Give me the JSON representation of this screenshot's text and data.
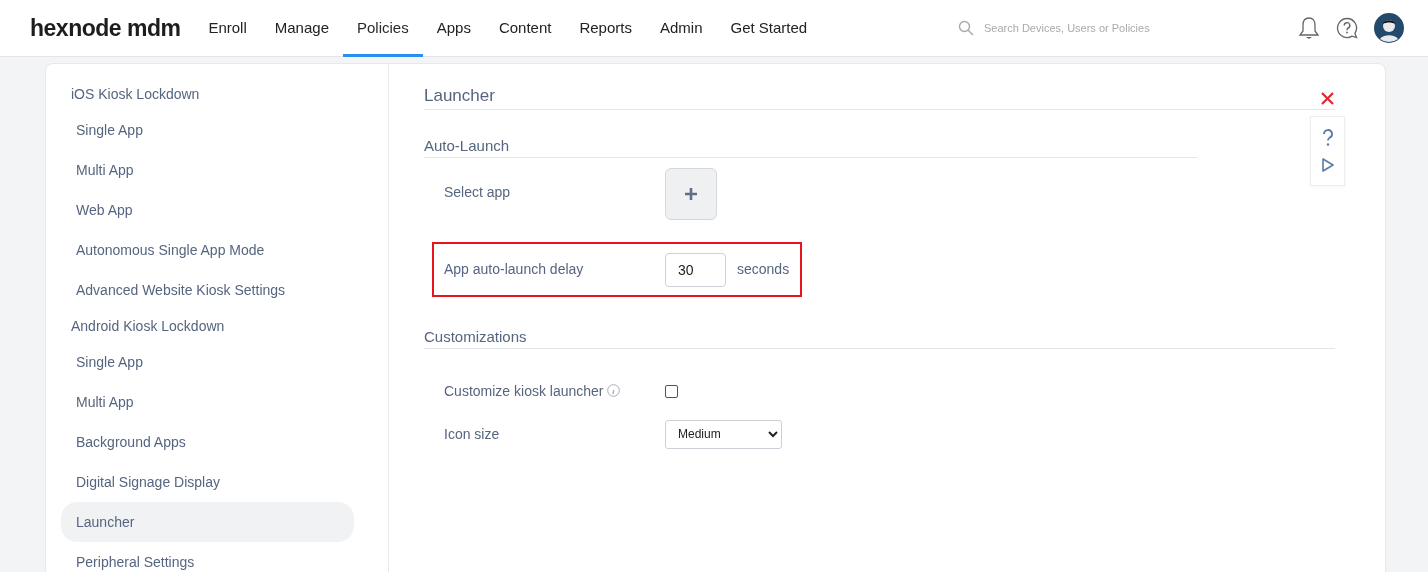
{
  "brand": {
    "name": "hexnode mdm"
  },
  "nav": [
    {
      "label": "Enroll",
      "selected": false
    },
    {
      "label": "Manage",
      "selected": false
    },
    {
      "label": "Policies",
      "selected": true
    },
    {
      "label": "Apps",
      "selected": false
    },
    {
      "label": "Content",
      "selected": false
    },
    {
      "label": "Reports",
      "selected": false
    },
    {
      "label": "Admin",
      "selected": false
    },
    {
      "label": "Get Started",
      "selected": false
    }
  ],
  "search": {
    "placeholder": "Search Devices, Users or Policies"
  },
  "sidebar": {
    "groups": [
      {
        "title": "iOS Kiosk Lockdown",
        "items": [
          {
            "label": "Single App",
            "selected": false
          },
          {
            "label": "Multi App",
            "selected": false
          },
          {
            "label": "Web App",
            "selected": false
          },
          {
            "label": "Autonomous Single App Mode",
            "selected": false
          },
          {
            "label": "Advanced Website Kiosk Settings",
            "selected": false
          }
        ]
      },
      {
        "title": "Android Kiosk Lockdown",
        "items": [
          {
            "label": "Single App",
            "selected": false
          },
          {
            "label": "Multi App",
            "selected": false
          },
          {
            "label": "Background Apps",
            "selected": false
          },
          {
            "label": "Digital Signage Display",
            "selected": false
          },
          {
            "label": "Launcher",
            "selected": true
          },
          {
            "label": "Peripheral Settings",
            "selected": false
          }
        ]
      }
    ]
  },
  "panel": {
    "title": "Launcher",
    "sections": [
      {
        "title": "Auto-Launch",
        "fields": [
          {
            "kind": "app-picker",
            "label": "Select app",
            "highlighted": false
          },
          {
            "kind": "number",
            "label": "App auto-launch delay",
            "value": "30",
            "unit": "seconds",
            "highlighted": true
          }
        ]
      },
      {
        "title": "Customizations",
        "fields": [
          {
            "kind": "checkbox",
            "label": "Customize kiosk launcher",
            "info": true,
            "checked": false,
            "highlighted": false
          },
          {
            "kind": "select",
            "label": "Icon size",
            "value": "Medium",
            "highlighted": false
          }
        ]
      }
    ]
  }
}
